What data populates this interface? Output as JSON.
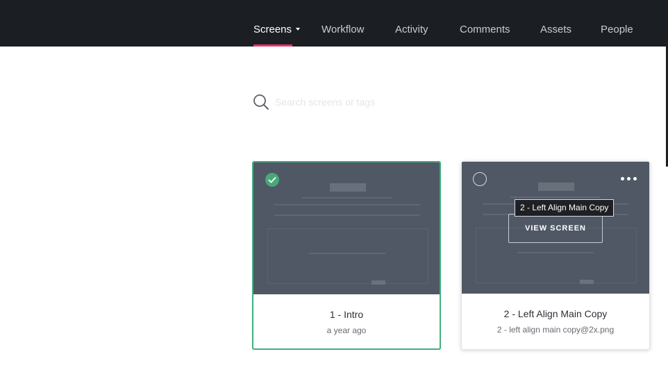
{
  "nav": {
    "items": [
      {
        "label": "Screens",
        "active": true
      },
      {
        "label": "Workflow"
      },
      {
        "label": "Activity"
      },
      {
        "label": "Comments"
      },
      {
        "label": "Assets"
      },
      {
        "label": "People"
      }
    ],
    "accent_color": "#e8326a"
  },
  "search": {
    "placeholder": "Search screens or tags"
  },
  "cards": [
    {
      "title": "1 - Intro",
      "subtitle": "a year ago",
      "selected": true,
      "select_icon": "check-circle-icon",
      "selected_color": "#3daf7e"
    },
    {
      "title": "2 - Left Align Main Copy",
      "subtitle": "2 - left align main copy@2x.png",
      "selected": false,
      "view_button_label": "VIEW SCREEN",
      "tooltip": "2 - Left Align Main Copy",
      "more_icon": "more-horizontal-icon"
    }
  ]
}
